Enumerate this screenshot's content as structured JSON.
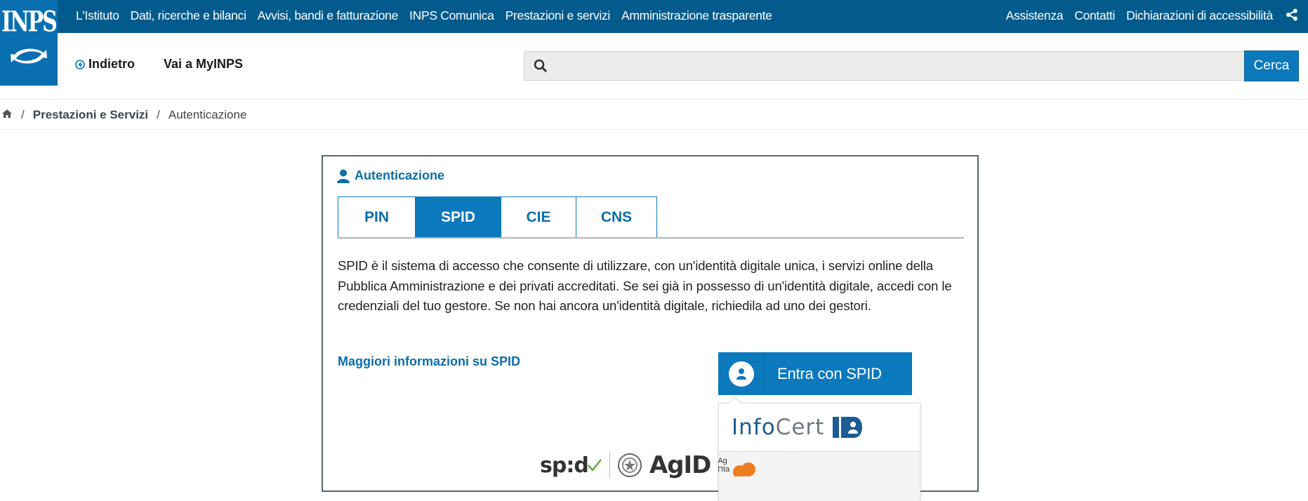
{
  "brand": {
    "logo_text": "INPS",
    "color_primary": "#025b8c",
    "color_accent": "#0c79bd"
  },
  "top_nav": {
    "left": [
      "L'Istituto",
      "Dati, ricerche e bilanci",
      "Avvisi, bandi e fatturazione",
      "INPS Comunica",
      "Prestazioni e servizi",
      "Amministrazione trasparente"
    ],
    "right": [
      "Assistenza",
      "Contatti",
      "Dichiarazioni di accessibilità"
    ],
    "share_icon": "share-icon"
  },
  "header": {
    "back_label": "Indietro",
    "myinps_label": "Vai a MyINPS",
    "search": {
      "placeholder": "",
      "value": "",
      "button_label": "Cerca"
    }
  },
  "breadcrumb": {
    "home_icon": "home-icon",
    "items": [
      "Prestazioni e Servizi",
      "Autenticazione"
    ]
  },
  "auth": {
    "title": "Autenticazione",
    "tabs": [
      {
        "label": "PIN",
        "active": false
      },
      {
        "label": "SPID",
        "active": true
      },
      {
        "label": "CIE",
        "active": false
      },
      {
        "label": "CNS",
        "active": false
      }
    ],
    "description": "SPID è il sistema di accesso che consente di utilizzare, con un'identità digitale unica, i servizi online della Pubblica Amministrazione e dei privati accreditati. Se sei già in possesso di un'identità digitale, accedi con le credenziali del tuo gestore. Se non hai ancora un'identità digitale, richiedila ad uno dei gestori.",
    "more_info_label": "Maggiori informazioni su SPID",
    "spid_button_label": "Entra con SPID",
    "providers": [
      {
        "name_part1": "Info",
        "name_part2": "Cert",
        "badge": "ID"
      }
    ],
    "footer_logos": {
      "spid": "sp:d",
      "agid": "AgID",
      "agid_caption_1": "Ag",
      "agid_caption_2": "l'Ita"
    }
  }
}
